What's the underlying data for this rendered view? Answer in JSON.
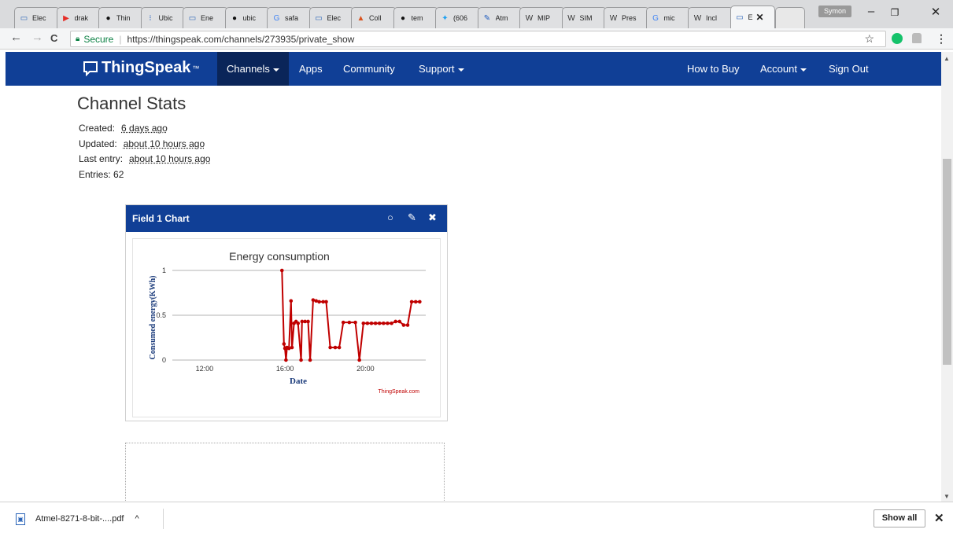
{
  "browser": {
    "tabs": [
      {
        "title": "Elec",
        "icon": "page-icon",
        "color": "#2a64b8",
        "glyph": "▭"
      },
      {
        "title": "drak",
        "icon": "youtube-icon",
        "color": "#e52d27",
        "glyph": "▶"
      },
      {
        "title": "Thin",
        "icon": "github-icon",
        "color": "#111111",
        "glyph": "●"
      },
      {
        "title": "Ubic",
        "icon": "dots-icon",
        "color": "#1e5bbd",
        "glyph": "⁝"
      },
      {
        "title": "Ene",
        "icon": "page-icon",
        "color": "#2a64b8",
        "glyph": "▭"
      },
      {
        "title": "ubic",
        "icon": "github-icon",
        "color": "#111111",
        "glyph": "●"
      },
      {
        "title": "safa",
        "icon": "google-icon",
        "color": "#4285f4",
        "glyph": "G"
      },
      {
        "title": "Elec",
        "icon": "page-icon",
        "color": "#2a64b8",
        "glyph": "▭"
      },
      {
        "title": "Coll",
        "icon": "matlab-icon",
        "color": "#d9531e",
        "glyph": "▲"
      },
      {
        "title": "tem",
        "icon": "github-icon",
        "color": "#111111",
        "glyph": "●"
      },
      {
        "title": "(606",
        "icon": "twitter-icon",
        "color": "#1da1f2",
        "glyph": "✦"
      },
      {
        "title": "Atm",
        "icon": "pen-icon",
        "color": "#1e5bbd",
        "glyph": "✎"
      },
      {
        "title": "MIP",
        "icon": "wikipedia-icon",
        "color": "#333333",
        "glyph": "W"
      },
      {
        "title": "SIM",
        "icon": "wikipedia-icon",
        "color": "#333333",
        "glyph": "W"
      },
      {
        "title": "Pres",
        "icon": "wikipedia-icon",
        "color": "#333333",
        "glyph": "W"
      },
      {
        "title": "mic",
        "icon": "google-icon",
        "color": "#4285f4",
        "glyph": "G"
      },
      {
        "title": "Incl",
        "icon": "wikipedia-icon",
        "color": "#333333",
        "glyph": "W"
      },
      {
        "title": "E",
        "icon": "page-icon",
        "color": "#2a64b8",
        "glyph": "▭"
      }
    ],
    "user": "Symon",
    "window_controls": {
      "minimize": "–",
      "restore": "❐",
      "close": "✕"
    },
    "nav": {
      "back": "←",
      "forward": "→",
      "reload": "C"
    },
    "secure_label": "Secure",
    "url": "https://thingspeak.com/channels/273935/private_show",
    "star": "☆"
  },
  "navbar": {
    "brand": "ThingSpeak",
    "brand_tm": "™",
    "items": [
      {
        "label": "Channels"
      },
      {
        "label": "Apps"
      },
      {
        "label": "Community"
      },
      {
        "label": "Support"
      },
      {
        "label": "How to Buy"
      },
      {
        "label": "Account"
      },
      {
        "label": "Sign Out"
      }
    ]
  },
  "channel_stats": {
    "title": "Channel Stats",
    "created_label": "Created:",
    "created_value": "6 days ago",
    "updated_label": "Updated:",
    "updated_value": "about 10 hours ago",
    "last_entry_label": "Last entry:",
    "last_entry_value": "about 10 hours ago",
    "entries_label": "Entries:",
    "entries_value": "62"
  },
  "widget": {
    "title": "Field 1 Chart",
    "comment_icon": "○",
    "edit_icon": "✎",
    "close_icon": "✖"
  },
  "chart_data": {
    "type": "line",
    "title": "Energy consumption",
    "xlabel": "Date",
    "ylabel": "Consumed energy(KWh)",
    "credit": "ThingSpeak.com",
    "color": "#c00000",
    "x_unit": "hours",
    "xlim": [
      10.4,
      23.0
    ],
    "ylim": [
      0,
      1
    ],
    "xticks": [
      {
        "value": 12,
        "label": "12:00"
      },
      {
        "value": 16,
        "label": "16:00"
      },
      {
        "value": 20,
        "label": "20:00"
      }
    ],
    "yticks": [
      {
        "value": 0,
        "label": "0"
      },
      {
        "value": 0.5,
        "label": "0.5"
      },
      {
        "value": 1,
        "label": "1"
      }
    ],
    "series": [
      {
        "points": [
          [
            15.85,
            1.0
          ],
          [
            15.95,
            0.18
          ],
          [
            16.0,
            0.13
          ],
          [
            16.05,
            0.0
          ],
          [
            16.1,
            0.14
          ],
          [
            16.2,
            0.13
          ],
          [
            16.3,
            0.66
          ],
          [
            16.35,
            0.14
          ],
          [
            16.45,
            0.41
          ],
          [
            16.55,
            0.43
          ],
          [
            16.65,
            0.41
          ],
          [
            16.8,
            0.0
          ],
          [
            16.85,
            0.43
          ],
          [
            17.0,
            0.43
          ],
          [
            17.15,
            0.43
          ],
          [
            17.25,
            0.0
          ],
          [
            17.4,
            0.67
          ],
          [
            17.55,
            0.66
          ],
          [
            17.7,
            0.65
          ],
          [
            17.9,
            0.65
          ],
          [
            18.05,
            0.65
          ],
          [
            18.25,
            0.14
          ],
          [
            18.5,
            0.14
          ],
          [
            18.7,
            0.14
          ],
          [
            18.9,
            0.42
          ],
          [
            19.2,
            0.42
          ],
          [
            19.5,
            0.42
          ],
          [
            19.7,
            0.0
          ],
          [
            19.9,
            0.41
          ],
          [
            20.1,
            0.41
          ],
          [
            20.3,
            0.41
          ],
          [
            20.5,
            0.41
          ],
          [
            20.7,
            0.41
          ],
          [
            20.9,
            0.41
          ],
          [
            21.1,
            0.41
          ],
          [
            21.3,
            0.41
          ],
          [
            21.5,
            0.43
          ],
          [
            21.7,
            0.43
          ],
          [
            21.9,
            0.39
          ],
          [
            22.1,
            0.39
          ],
          [
            22.3,
            0.65
          ],
          [
            22.5,
            0.65
          ],
          [
            22.7,
            0.65
          ]
        ]
      }
    ]
  },
  "download_shelf": {
    "filename": "Atmel-8271-8-bit-....pdf",
    "caret": "^",
    "show_all": "Show all",
    "close": "✕"
  }
}
